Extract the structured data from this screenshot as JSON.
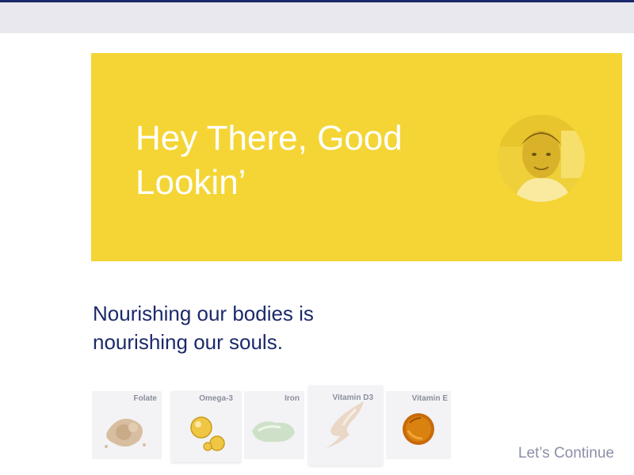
{
  "hero": {
    "title": "Hey There, Good Lookin’",
    "background_color": "#f4d535",
    "avatar": "user-photo"
  },
  "tagline": "Nourishing our bodies is nourishing our souls.",
  "nutrients": [
    {
      "label": "Folate",
      "icon": "folate-powder"
    },
    {
      "label": "Omega-3",
      "icon": "omega3-capsules"
    },
    {
      "label": "Iron",
      "icon": "iron-gel"
    },
    {
      "label": "Vitamin D3",
      "icon": "vitamin-d3-cream"
    },
    {
      "label": "Vitamin E",
      "icon": "vitamin-e-oil"
    }
  ],
  "continue_label": "Let’s Continue",
  "colors": {
    "navy": "#1c2a6b",
    "yellow": "#f4d535",
    "muted": "#8b90a8"
  }
}
